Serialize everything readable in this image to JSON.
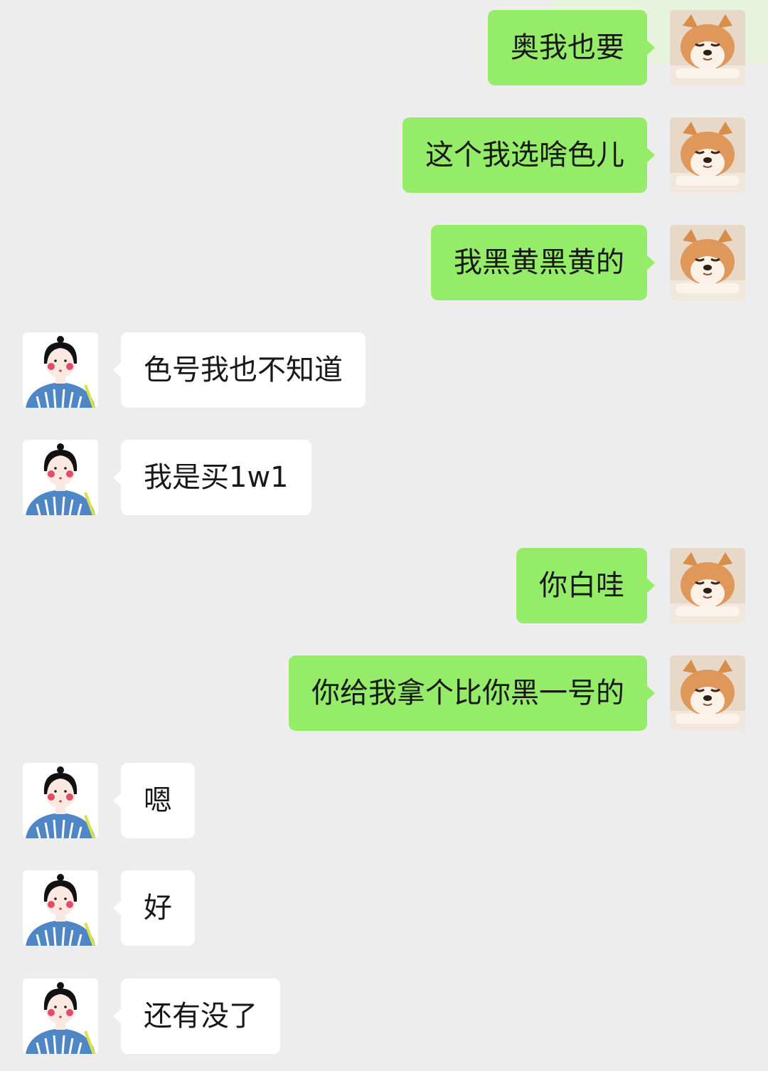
{
  "colors": {
    "background": "#ededed",
    "sent_bubble": "#95ec69",
    "received_bubble": "#ffffff",
    "text": "#181818"
  },
  "avatars": {
    "me": "shiba-dog-avatar",
    "them": "cartoon-girl-avatar"
  },
  "messages": [
    {
      "from": "me",
      "text": "奥我也要"
    },
    {
      "from": "me",
      "text": "这个我选啥色儿"
    },
    {
      "from": "me",
      "text": "我黑黄黑黄的"
    },
    {
      "from": "them",
      "text": "色号我也不知道"
    },
    {
      "from": "them",
      "text": "我是买1w1"
    },
    {
      "from": "me",
      "text": "你白哇"
    },
    {
      "from": "me",
      "text": "你给我拿个比你黑一号的"
    },
    {
      "from": "them",
      "text": "嗯"
    },
    {
      "from": "them",
      "text": "好"
    },
    {
      "from": "them",
      "text": "还有没了"
    }
  ]
}
